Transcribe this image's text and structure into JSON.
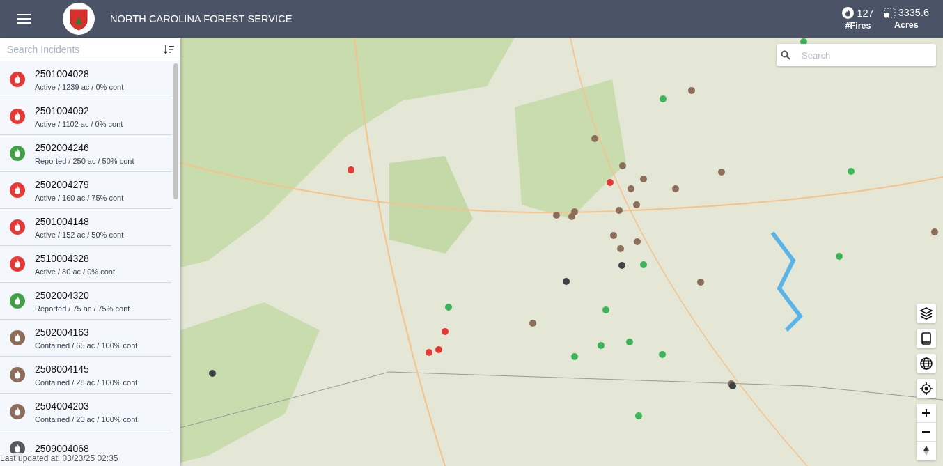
{
  "header": {
    "title": "NORTH CAROLINA FOREST SERVICE",
    "stats": [
      {
        "kind": "fires",
        "value": "127",
        "label": "#Fires"
      },
      {
        "kind": "acres",
        "value": "3335.6",
        "label": "Acres"
      }
    ]
  },
  "sidebar": {
    "search": {
      "placeholder": "Search Incidents"
    },
    "incidents": [
      {
        "id": "2501004028",
        "detail": "Active / 1239 ac / 0% cont",
        "color": "#e53935"
      },
      {
        "id": "2501004092",
        "detail": "Active / 1102 ac / 0% cont",
        "color": "#e53935"
      },
      {
        "id": "2502004246",
        "detail": "Reported / 250 ac / 50% cont",
        "color": "#43a047"
      },
      {
        "id": "2502004279",
        "detail": "Active / 160 ac / 75% cont",
        "color": "#e53935"
      },
      {
        "id": "2501004148",
        "detail": "Active / 152 ac / 50% cont",
        "color": "#e53935"
      },
      {
        "id": "2510004328",
        "detail": "Active / 80 ac / 0% cont",
        "color": "#e53935"
      },
      {
        "id": "2502004320",
        "detail": "Reported / 75 ac / 75% cont",
        "color": "#43a047"
      },
      {
        "id": "2502004163",
        "detail": "Contained / 65 ac / 100% cont",
        "color": "#8d6e5a"
      },
      {
        "id": "2508004145",
        "detail": "Contained / 28 ac / 100% cont",
        "color": "#8d6e5a"
      },
      {
        "id": "2504004203",
        "detail": "Contained / 20 ac / 100% cont",
        "color": "#8d6e5a"
      },
      {
        "id": "2509004068",
        "color": "#55585e"
      }
    ],
    "last_updated": "Last updated at: 03/23/25 02:35"
  },
  "map": {
    "search": {
      "placeholder": "Search"
    },
    "markers": [
      {
        "color": "#e53935"
      },
      {
        "color": "#3cb55a"
      },
      {
        "color": "#8d6e5a"
      },
      {
        "color": "#8d6e5a"
      },
      {
        "color": "#8d6e5a"
      },
      {
        "color": "#e53935"
      },
      {
        "color": "#8d6e5a"
      },
      {
        "color": "#8d6e5a"
      },
      {
        "color": "#8d6e5a"
      },
      {
        "color": "#8d6e5a"
      },
      {
        "color": "#3cb55a"
      },
      {
        "color": "#8d6e5a"
      },
      {
        "color": "#8d6e5a"
      },
      {
        "color": "#8d6e5a"
      },
      {
        "color": "#8d6e5a"
      },
      {
        "color": "#8d6e5a"
      },
      {
        "color": "#8d6e5a"
      },
      {
        "color": "#8d6e5a"
      },
      {
        "color": "#8d6e5a"
      },
      {
        "color": "#3d4148"
      },
      {
        "color": "#3cb55a"
      },
      {
        "color": "#3d4148"
      },
      {
        "color": "#8d6e5a"
      },
      {
        "color": "#3cb55a"
      },
      {
        "color": "#3cb55a"
      },
      {
        "color": "#e53935"
      },
      {
        "color": "#8d6e5a"
      },
      {
        "color": "#e53935"
      },
      {
        "color": "#e53935"
      },
      {
        "color": "#3cb55a"
      },
      {
        "color": "#3cb55a"
      },
      {
        "color": "#3cb55a"
      },
      {
        "color": "#3cb55a"
      },
      {
        "color": "#3d4148"
      },
      {
        "color": "#8d6e5a"
      },
      {
        "color": "#3d4148"
      },
      {
        "color": "#3cb55a"
      },
      {
        "color": "#8d6e5a"
      },
      {
        "color": "#3cb55a"
      },
      {
        "color": "#3cb55a"
      }
    ]
  }
}
